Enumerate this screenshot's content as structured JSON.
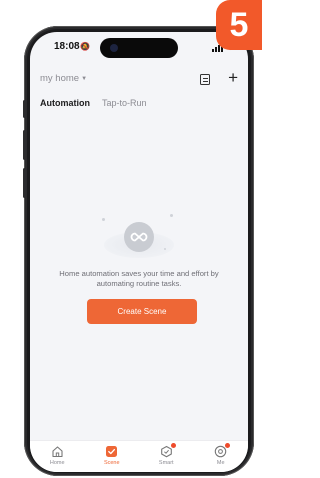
{
  "step_badge": "5",
  "status_bar": {
    "time": "18:08",
    "bell_icon": "bell-muted-icon",
    "wifi_icon": "wifi-icon",
    "signal_icon": "cellular-signal-icon"
  },
  "header": {
    "home_selector": "my home",
    "caret_icon": "chevron-down-icon",
    "log_icon": "document-icon",
    "add_icon": "plus-icon"
  },
  "tabs": [
    {
      "label": "Automation",
      "active": true
    },
    {
      "label": "Tap-to-Run",
      "active": false
    }
  ],
  "empty_state": {
    "icon": "automation-loop-icon",
    "message": "Home automation saves your time and effort by automating routine tasks.",
    "button_label": "Create Scene"
  },
  "bottom_nav": [
    {
      "label": "Home",
      "icon": "home-icon",
      "active": false,
      "dot": false
    },
    {
      "label": "Scene",
      "icon": "scene-check-icon",
      "active": true,
      "dot": false
    },
    {
      "label": "Smart",
      "icon": "smart-icon",
      "active": false,
      "dot": true
    },
    {
      "label": "Me",
      "icon": "profile-icon",
      "active": false,
      "dot": true
    }
  ],
  "colors": {
    "accent": "#ee6736",
    "badge": "#f2592a",
    "background": "#f4f5f8",
    "notification_dot": "#ee4b2b"
  }
}
